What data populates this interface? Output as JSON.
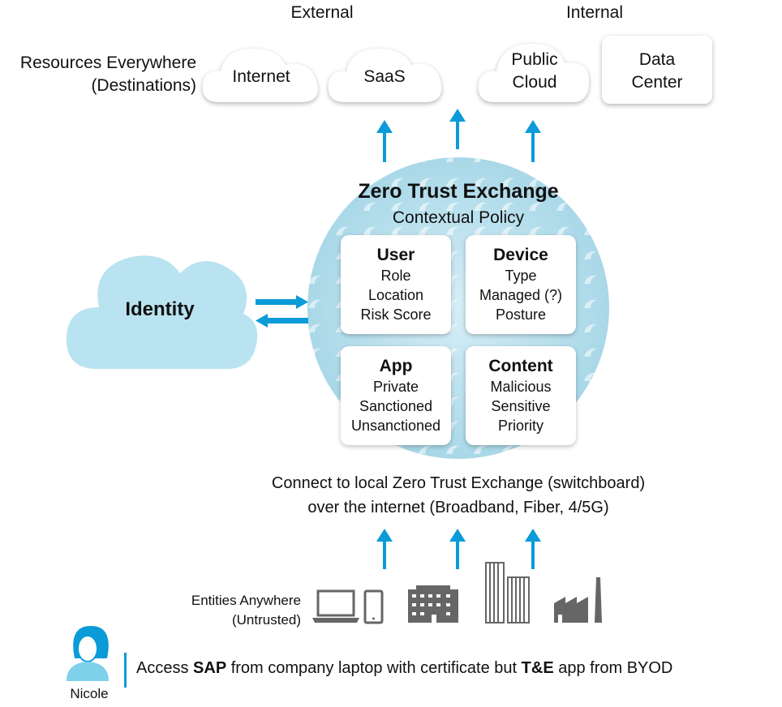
{
  "header": {
    "external": "External",
    "internal": "Internal",
    "resources_line1": "Resources Everywhere",
    "resources_line2": "(Destinations)"
  },
  "destinations": [
    {
      "label": "Internet"
    },
    {
      "label": "SaaS"
    },
    {
      "label_line1": "Public",
      "label_line2": "Cloud"
    },
    {
      "label_line1": "Data",
      "label_line2": "Center"
    }
  ],
  "exchange": {
    "title": "Zero Trust Exchange",
    "subtitle": "Contextual Policy",
    "boxes": [
      {
        "title": "User",
        "items": [
          "Role",
          "Location",
          "Risk Score"
        ]
      },
      {
        "title": "Device",
        "items": [
          "Type",
          "Managed (?)",
          "Posture"
        ]
      },
      {
        "title": "App",
        "items": [
          "Private",
          "Sanctioned",
          "Unsanctioned"
        ]
      },
      {
        "title": "Content",
        "items": [
          "Malicious",
          "Sensitive",
          "Priority"
        ]
      }
    ]
  },
  "identity": {
    "label": "Identity"
  },
  "connect": {
    "line1": "Connect to local Zero Trust Exchange (switchboard)",
    "line2": "over the internet (Broadband, Fiber, 4/5G)"
  },
  "entities": {
    "line1": "Entities Anywhere",
    "line2": "(Untrusted)",
    "icons": [
      "laptop-icon",
      "phone-icon",
      "office-building-icon",
      "skyscraper-icon",
      "factory-icon"
    ]
  },
  "user": {
    "name": "Nicole",
    "s1": "Access ",
    "b1": "SAP",
    "s2": " from company laptop with certificate but ",
    "b2": "T&E",
    "s3": " app from BYOD"
  },
  "colors": {
    "accent": "#0a9bd8",
    "sphere": "#bfe3ef",
    "identity_cloud": "#b9e3f1",
    "icon_gray": "#666666"
  }
}
